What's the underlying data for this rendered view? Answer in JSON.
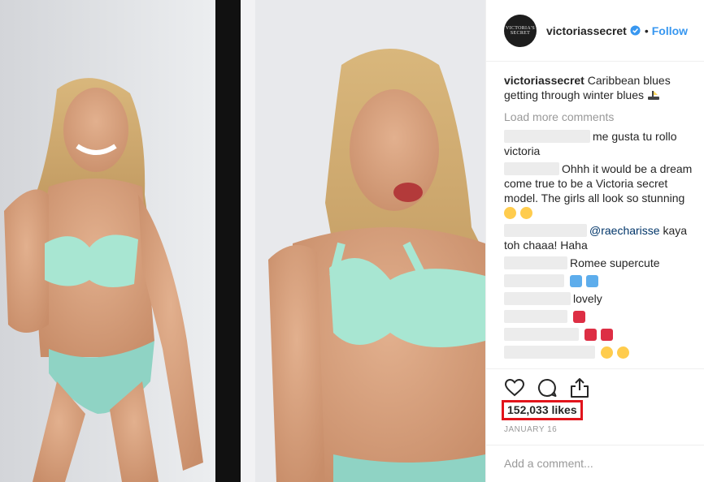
{
  "account": {
    "username": "victoriassecret",
    "avatar_text_line1": "VICTORIA'S",
    "avatar_text_line2": "SECRET",
    "follow_separator": "•",
    "follow_label": "Follow"
  },
  "caption": {
    "username": "victoriassecret",
    "text": "Caribbean blues getting through winter blues"
  },
  "load_more_label": "Load more comments",
  "comments": [
    {
      "text": "me gusta tu rollo victoria"
    },
    {
      "text": "Ohhh it would be a dream come true to be a Victoria secret model. The girls all look so stunning"
    },
    {
      "mention": "@raecharisse",
      "text": "kaya toh chaaa! Haha"
    },
    {
      "text": "Romee supercute"
    },
    {
      "text": ""
    },
    {
      "text": "lovely"
    },
    {
      "text": ""
    },
    {
      "text": ""
    },
    {
      "text": ""
    }
  ],
  "likes_label": "152,033 likes",
  "date_label": "JANUARY 16",
  "add_comment_placeholder": "Add a comment...",
  "icons": {
    "verified": "verified-badge-icon",
    "like": "heart-icon",
    "comment": "speech-bubble-icon",
    "share": "share-icon",
    "caption_emoji": "rowboat-emoji-icon"
  },
  "colors": {
    "link_blue": "#3897f0",
    "muted_gray": "#999999",
    "highlight_red": "#e1141c",
    "bra_mint": "#a8e6d2",
    "photo_divider": "#111111"
  }
}
